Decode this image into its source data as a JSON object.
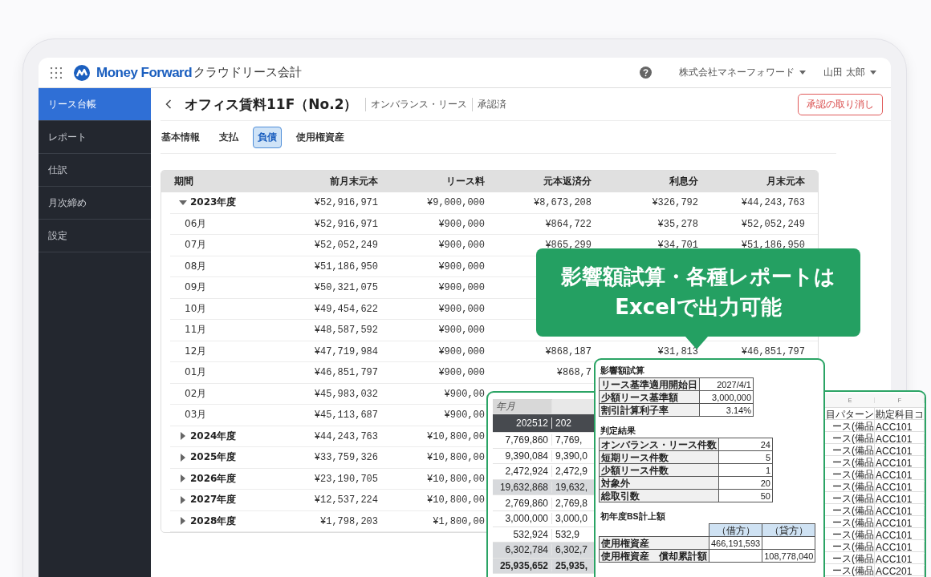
{
  "header": {
    "brand": "Money Forward",
    "product": "クラウドリース会計",
    "company": "株式会社マネーフォワード",
    "user": "山田 太郎"
  },
  "sidebar": {
    "items": [
      {
        "label": "リース台帳",
        "selected": true
      },
      {
        "label": "レポート",
        "selected": false
      },
      {
        "label": "仕訳",
        "selected": false
      },
      {
        "label": "月次締め",
        "selected": false
      },
      {
        "label": "設定",
        "selected": false
      }
    ]
  },
  "page": {
    "title": "オフィス賃料11F（No.2）",
    "type": "オンバランス・リース",
    "status": "承認済",
    "cancel_button": "承認の取り消し"
  },
  "tabs": [
    {
      "label": "基本情報",
      "selected": false
    },
    {
      "label": "支払",
      "selected": false
    },
    {
      "label": "負債",
      "selected": true
    },
    {
      "label": "使用権資産",
      "selected": false
    }
  ],
  "table": {
    "columns": [
      "期間",
      "前月末元本",
      "リース料",
      "元本返済分",
      "利息分",
      "月末元本"
    ],
    "rows": [
      {
        "expanded": true,
        "cells": [
          "2023年度",
          "¥52,916,971",
          "¥9,000,000",
          "¥8,673,208",
          "¥326,792",
          "¥44,243,763"
        ],
        "children": [
          {
            "cells": [
              "06月",
              "¥52,916,971",
              "¥900,000",
              "¥864,722",
              "¥35,278",
              "¥52,052,249"
            ]
          },
          {
            "cells": [
              "07月",
              "¥52,052,249",
              "¥900,000",
              "¥865,299",
              "¥34,701",
              "¥51,186,950"
            ]
          },
          {
            "cells": [
              "08月",
              "¥51,186,950",
              "¥900,000",
              null,
              null,
              null
            ]
          },
          {
            "cells": [
              "09月",
              "¥50,321,075",
              "¥900,000",
              null,
              null,
              null
            ]
          },
          {
            "cells": [
              "10月",
              "¥49,454,622",
              "¥900,000",
              null,
              null,
              null
            ]
          },
          {
            "cells": [
              "11月",
              "¥48,587,592",
              "¥900,000",
              null,
              null,
              null
            ]
          },
          {
            "cells": [
              "12月",
              "¥47,719,984",
              "¥900,000",
              "¥868,187",
              "¥31,813",
              "¥46,851,797"
            ]
          },
          {
            "cells": [
              "01月",
              "¥46,851,797",
              "¥900,000",
              "¥868,7",
              null,
              null
            ]
          },
          {
            "cells": [
              "02月",
              "¥45,983,032",
              "¥900,00",
              null,
              null,
              null
            ]
          },
          {
            "cells": [
              "03月",
              "¥45,113,687",
              "¥900,00",
              null,
              null,
              null
            ]
          }
        ]
      },
      {
        "expanded": false,
        "cells": [
          "2024年度",
          "¥44,243,763",
          "¥10,800,00",
          null,
          null,
          null
        ]
      },
      {
        "expanded": false,
        "cells": [
          "2025年度",
          "¥33,759,326",
          "¥10,800,00",
          null,
          null,
          null
        ]
      },
      {
        "expanded": false,
        "cells": [
          "2026年度",
          "¥23,190,705",
          "¥10,800,00",
          null,
          null,
          null
        ]
      },
      {
        "expanded": false,
        "cells": [
          "2027年度",
          "¥12,537,224",
          "¥10,800,00",
          null,
          null,
          null
        ]
      },
      {
        "expanded": false,
        "cells": [
          "2028年度",
          "¥1,798,203",
          "¥1,800,00",
          null,
          null,
          null
        ]
      }
    ]
  },
  "callout": {
    "lines": [
      "影響額試算・各種レポートは",
      "Excelで出力可能"
    ]
  },
  "sheet_monthly": {
    "label": "年月",
    "columns": [
      "202512",
      "202"
    ],
    "rows": [
      {
        "kind": "plain",
        "cells": [
          "7,769,860",
          "7,769,"
        ]
      },
      {
        "kind": "plain",
        "cells": [
          "9,390,084",
          "9,390,0"
        ]
      },
      {
        "kind": "plain",
        "cells": [
          "2,472,924",
          "2,472,9"
        ]
      },
      {
        "kind": "subtotal",
        "cells": [
          "19,632,868",
          "19,632,"
        ]
      },
      {
        "kind": "plain",
        "cells": [
          "2,769,860",
          "2,769,8"
        ]
      },
      {
        "kind": "plain",
        "cells": [
          "3,000,000",
          "3,000,0"
        ]
      },
      {
        "kind": "plain",
        "cells": [
          "532,924",
          "532,9"
        ]
      },
      {
        "kind": "subtotal",
        "cells": [
          "6,302,784",
          "6,302,7"
        ]
      },
      {
        "kind": "total",
        "cells": [
          "25,935,652",
          "25,935,"
        ]
      }
    ]
  },
  "sheet_report": {
    "sections": [
      {
        "title": "影響額試算",
        "rows": [
          [
            "リース基準適用開始日",
            "2027/4/1"
          ],
          [
            "少額リース基準額",
            "3,000,000"
          ],
          [
            "割引計算利子率",
            "3.14%"
          ]
        ]
      },
      {
        "title": "判定結果",
        "rows": [
          [
            "オンバランス・リース件数",
            "24"
          ],
          [
            "短期リース件数",
            "5"
          ],
          [
            "少額リース件数",
            "1"
          ],
          [
            "対象外",
            "20"
          ],
          [
            "総取引数",
            "50"
          ]
        ]
      },
      {
        "title": "初年度BS計上額",
        "header": [
          "（借方）",
          "（貸方）"
        ],
        "rows": [
          [
            "使用権資産",
            "466,191,593",
            null
          ],
          [
            "使用権資産　償却累計額",
            null,
            "108,778,040"
          ]
        ]
      }
    ]
  },
  "sheet_accounts": {
    "columns": [
      "E",
      "F"
    ],
    "headings": [
      "目パターン",
      "勘定科目コ"
    ],
    "rows": [
      [
        "ース(備品",
        "ACC101"
      ],
      [
        "ース(備品",
        "ACC101"
      ],
      [
        "ース(備品",
        "ACC101"
      ],
      [
        "ース(備品",
        "ACC101"
      ],
      [
        "ース(備品",
        "ACC101"
      ],
      [
        "ース(備品",
        "ACC101"
      ],
      [
        "ース(備品",
        "ACC101"
      ],
      [
        "ース(備品",
        "ACC101"
      ],
      [
        "ース(備品",
        "ACC101"
      ],
      [
        "ース(備品",
        "ACC101"
      ],
      [
        "ース(備品",
        "ACC101"
      ],
      [
        "ース(備品",
        "ACC101"
      ],
      [
        "ース(備品",
        "ACC201"
      ]
    ]
  }
}
